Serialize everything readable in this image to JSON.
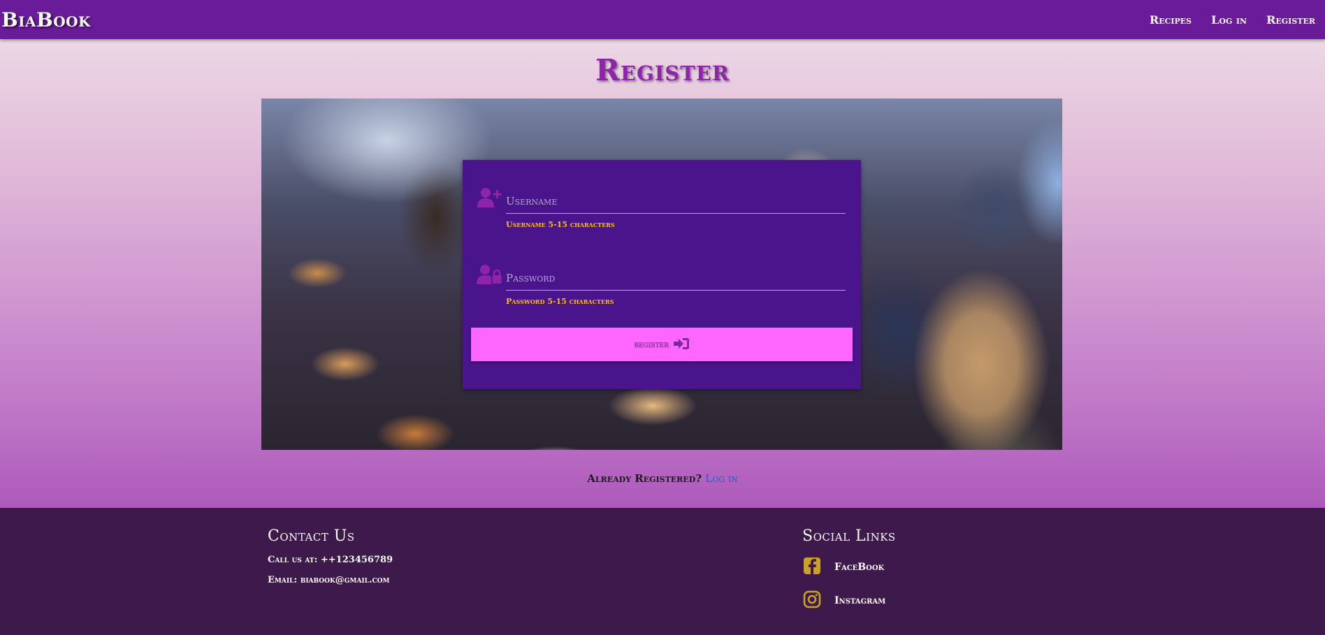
{
  "navbar": {
    "brand": "BiaBook",
    "links": [
      "Recipes",
      "Log in",
      "Register"
    ]
  },
  "page": {
    "title": "Register"
  },
  "form": {
    "username": {
      "placeholder": "Username",
      "value": "",
      "helper": "Username 5-15 characters",
      "icon": "user-plus-icon"
    },
    "password": {
      "placeholder": "Password",
      "value": "",
      "helper": "Password 5-15 characters",
      "icon": "user-lock-icon"
    },
    "submit": {
      "label": "register",
      "icon": "sign-in-icon"
    }
  },
  "already": {
    "text": "Already Registered?",
    "link": "Log in"
  },
  "footer": {
    "contact": {
      "heading": "Contact Us",
      "phone": "Call us at: ++123456789",
      "email": "Email: biabook@gmail.com"
    },
    "social": {
      "heading": "Social Links",
      "items": [
        {
          "label": "FaceBook",
          "icon": "facebook-icon"
        },
        {
          "label": "Instagram",
          "icon": "instagram-icon"
        }
      ]
    }
  },
  "colors": {
    "navbar": "#6a1b9a",
    "title": "#8e24aa",
    "form_card": "#4a148c",
    "button": "#ff66ff",
    "helper_text": "#ffc107",
    "footer": "#3e1a4c",
    "social_icon": "#c9a227"
  }
}
